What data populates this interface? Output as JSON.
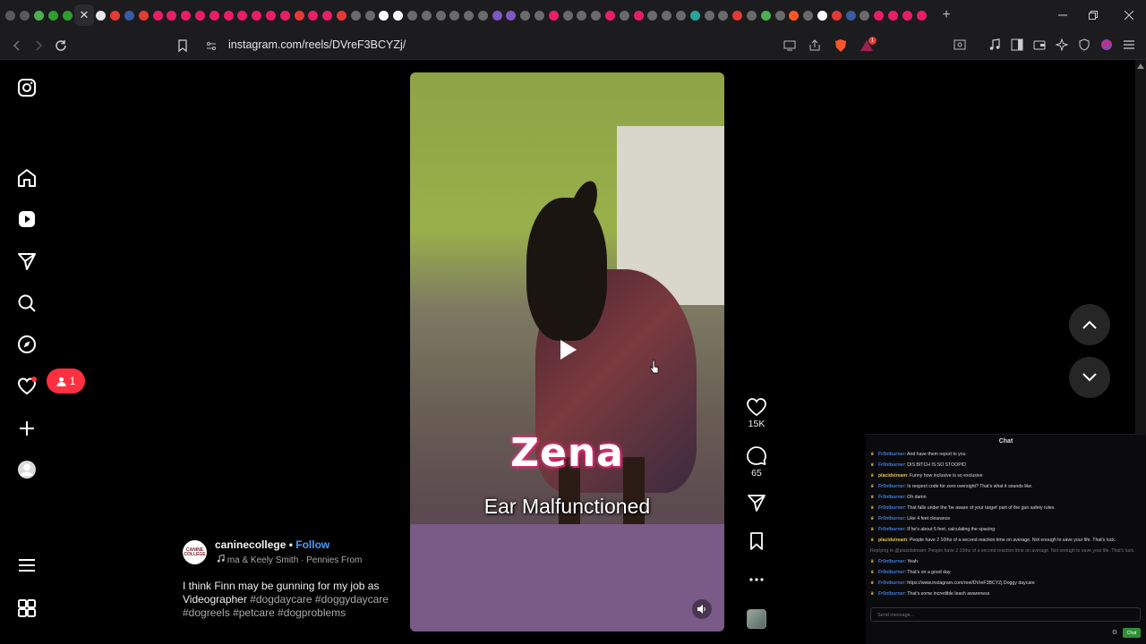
{
  "browser": {
    "tab_favicon_colors": [
      "#5a5a5a",
      "#5a5a5a",
      "#4caf50",
      "#2e9e2e",
      "#2e9e2e",
      "#e8e8e8",
      "#e53935",
      "#3a5ba0",
      "#e53935",
      "#e91e63",
      "#e91e63",
      "#e91e63",
      "#e91e63",
      "#e91e63",
      "#e91e63",
      "#e91e63",
      "#e91e63",
      "#e91e63",
      "#e91e63",
      "#e53935",
      "#e91e63",
      "#e91e63",
      "#e53935",
      "#6a6a6a",
      "#6a6a6a",
      "#ffffff",
      "#ffffff",
      "#6a6a6a",
      "#6a6a6a",
      "#6a6a6a",
      "#6a6a6a",
      "#6a6a6a",
      "#6a6a6a",
      "#7e57c2",
      "#7e57c2",
      "#6a6a6a",
      "#6a6a6a",
      "#e91e63",
      "#6a6a6a",
      "#6a6a6a",
      "#6a6a6a",
      "#e91e63",
      "#6a6a6a",
      "#e91e63",
      "#6a6a6a",
      "#6a6a6a",
      "#6a6a6a",
      "#26a69a",
      "#6a6a6a",
      "#6a6a6a",
      "#e53935",
      "#6a6a6a",
      "#4caf50",
      "#6a6a6a",
      "#ff5722",
      "#6a6a6a",
      "#ffffff",
      "#e53935",
      "#3a5ba0",
      "#6a6a6a",
      "#e91e63",
      "#e91e63",
      "#e91e63",
      "#e91e63"
    ],
    "tab_close_glyph": "✕",
    "new_tab_glyph": "+",
    "url": "instagram.com/reels/DVreF3BCYZj/",
    "alert_badge": "1"
  },
  "sidebar": {
    "notification_count": "1"
  },
  "reel": {
    "overlay_title": "Zena",
    "overlay_subtitle": "Ear Malfunctioned",
    "username": "caninecollege",
    "separator": "•",
    "follow_label": "Follow",
    "avatar_text": "CANINE COLLEGE",
    "audio": "ma & Keely Smith · Pennies From",
    "caption_text": "I think Finn may be gunning for my job as Videographer",
    "hashtags": [
      "#dogdaycare",
      "#doggydaycare",
      "#dogreels",
      "#petcare",
      "#dogproblems"
    ],
    "likes": "15K",
    "comments": "65"
  },
  "chat": {
    "title": "Chat",
    "input_placeholder": "Send message...",
    "send_label": "Chat",
    "messages": [
      {
        "user": "Fr0ntburner",
        "color": "#3f7be0",
        "text": "And have them report to you"
      },
      {
        "user": "Fr0ntburner",
        "color": "#3f7be0",
        "text": "DIS BITCH IS SO STOOPID"
      },
      {
        "user": "placidstream",
        "color": "#e3c44a",
        "text": "Funny how inclusive is so exclusive"
      },
      {
        "user": "Fr0ntburner",
        "color": "#3f7be0",
        "text": "Is respect code for zero oversight? That's what it sounds like."
      },
      {
        "user": "Fr0ntburner",
        "color": "#3f7be0",
        "text": "Oh damn"
      },
      {
        "user": "Fr0ntburner",
        "color": "#3f7be0",
        "text": "That falls under the 'be aware of your target' part of the gun safety rules."
      },
      {
        "user": "Fr0ntburner",
        "color": "#3f7be0",
        "text": "Like 4 feet clearance"
      },
      {
        "user": "Fr0ntburner",
        "color": "#3f7be0",
        "text": "If he's about 6 feet, calculating the spacing"
      },
      {
        "user": "placidstream",
        "color": "#e3c44a",
        "text": "People have 2 10ths of a second reaction time on average. Not enough to save your life. That's luck."
      },
      {
        "user": "",
        "color": "#777777",
        "text": "Replying to @placidstream: People have 2 10ths of a second reaction time on average. Not enough to save your life. That's luck."
      },
      {
        "user": "Fr0ntburner",
        "color": "#3f7be0",
        "text": "Yeah"
      },
      {
        "user": "Fr0ntburner",
        "color": "#3f7be0",
        "text": "That's on a good day"
      },
      {
        "user": "Fr0ntburner",
        "color": "#3f7be0",
        "text": "https://www.instagram.com/reel/DVreF3BCYZj Doggy daycare"
      },
      {
        "user": "Fr0ntburner",
        "color": "#3f7be0",
        "text": "That's some incredible leash awareness"
      }
    ]
  }
}
